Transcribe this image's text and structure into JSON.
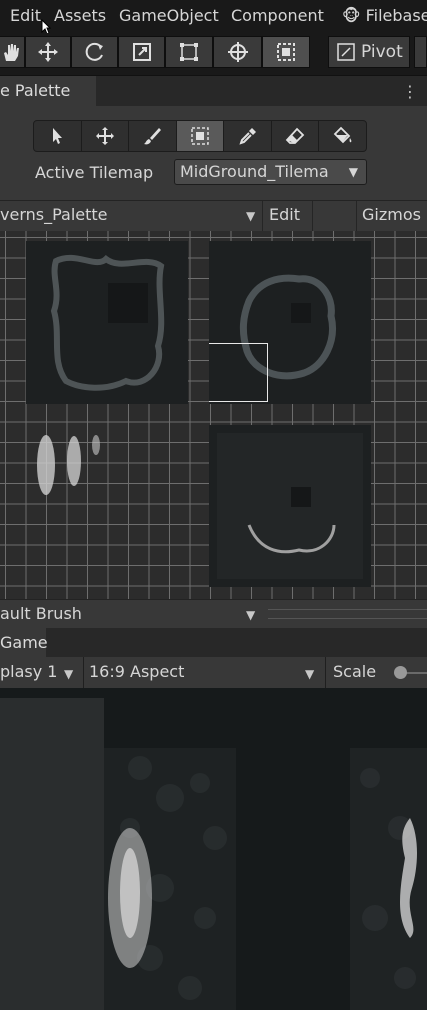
{
  "menubar": {
    "items": [
      "Edit",
      "Assets",
      "GameObject",
      "Component",
      "Filebase"
    ]
  },
  "toolbar": {
    "tools": [
      "hand-tool",
      "move-tool",
      "rotate-tool",
      "scale-tool",
      "rect-tool",
      "transform-tool",
      "custom-tool"
    ],
    "active_tool": "custom-tool",
    "pivot_label": "Pivot"
  },
  "palette_window": {
    "tab_label": "e Palette",
    "tools": [
      "select",
      "move",
      "paint",
      "box-fill",
      "picker",
      "erase",
      "fill"
    ],
    "active_tool": "box-fill",
    "active_tilemap_label": "Active Tilemap",
    "active_tilemap_value": "MidGround_Tilema",
    "palette_name": "verns_Palette",
    "edit_label": "Edit",
    "gizmos_label": "Gizmos",
    "brush_name": "ault Brush"
  },
  "game_window": {
    "tab_label": "Game",
    "display_label": "plasy 1",
    "aspect_label": "16:9 Aspect",
    "scale_label": "Scale"
  },
  "colors": {
    "editor_bg": "#383838",
    "menubar_bg": "#191919",
    "active_button": "#5a5a5a",
    "grid_line": "#6e6e6e"
  }
}
